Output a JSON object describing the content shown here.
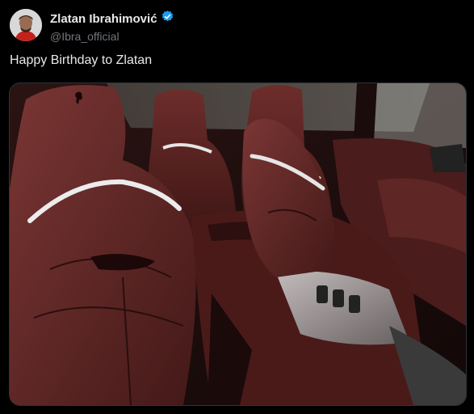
{
  "tweet": {
    "author_name": "Zlatan Ibrahimović",
    "author_handle": "@Ibra_official",
    "verified": true,
    "text": "Happy Birthday to Zlatan"
  },
  "media": {
    "icons": [
      "ferrari-logo-icon"
    ]
  },
  "colors": {
    "background": "#000000",
    "text_primary": "#e7e9ea",
    "text_secondary": "#71767b",
    "verified_badge": "#1d9bf0",
    "leather": "#5a2423"
  }
}
